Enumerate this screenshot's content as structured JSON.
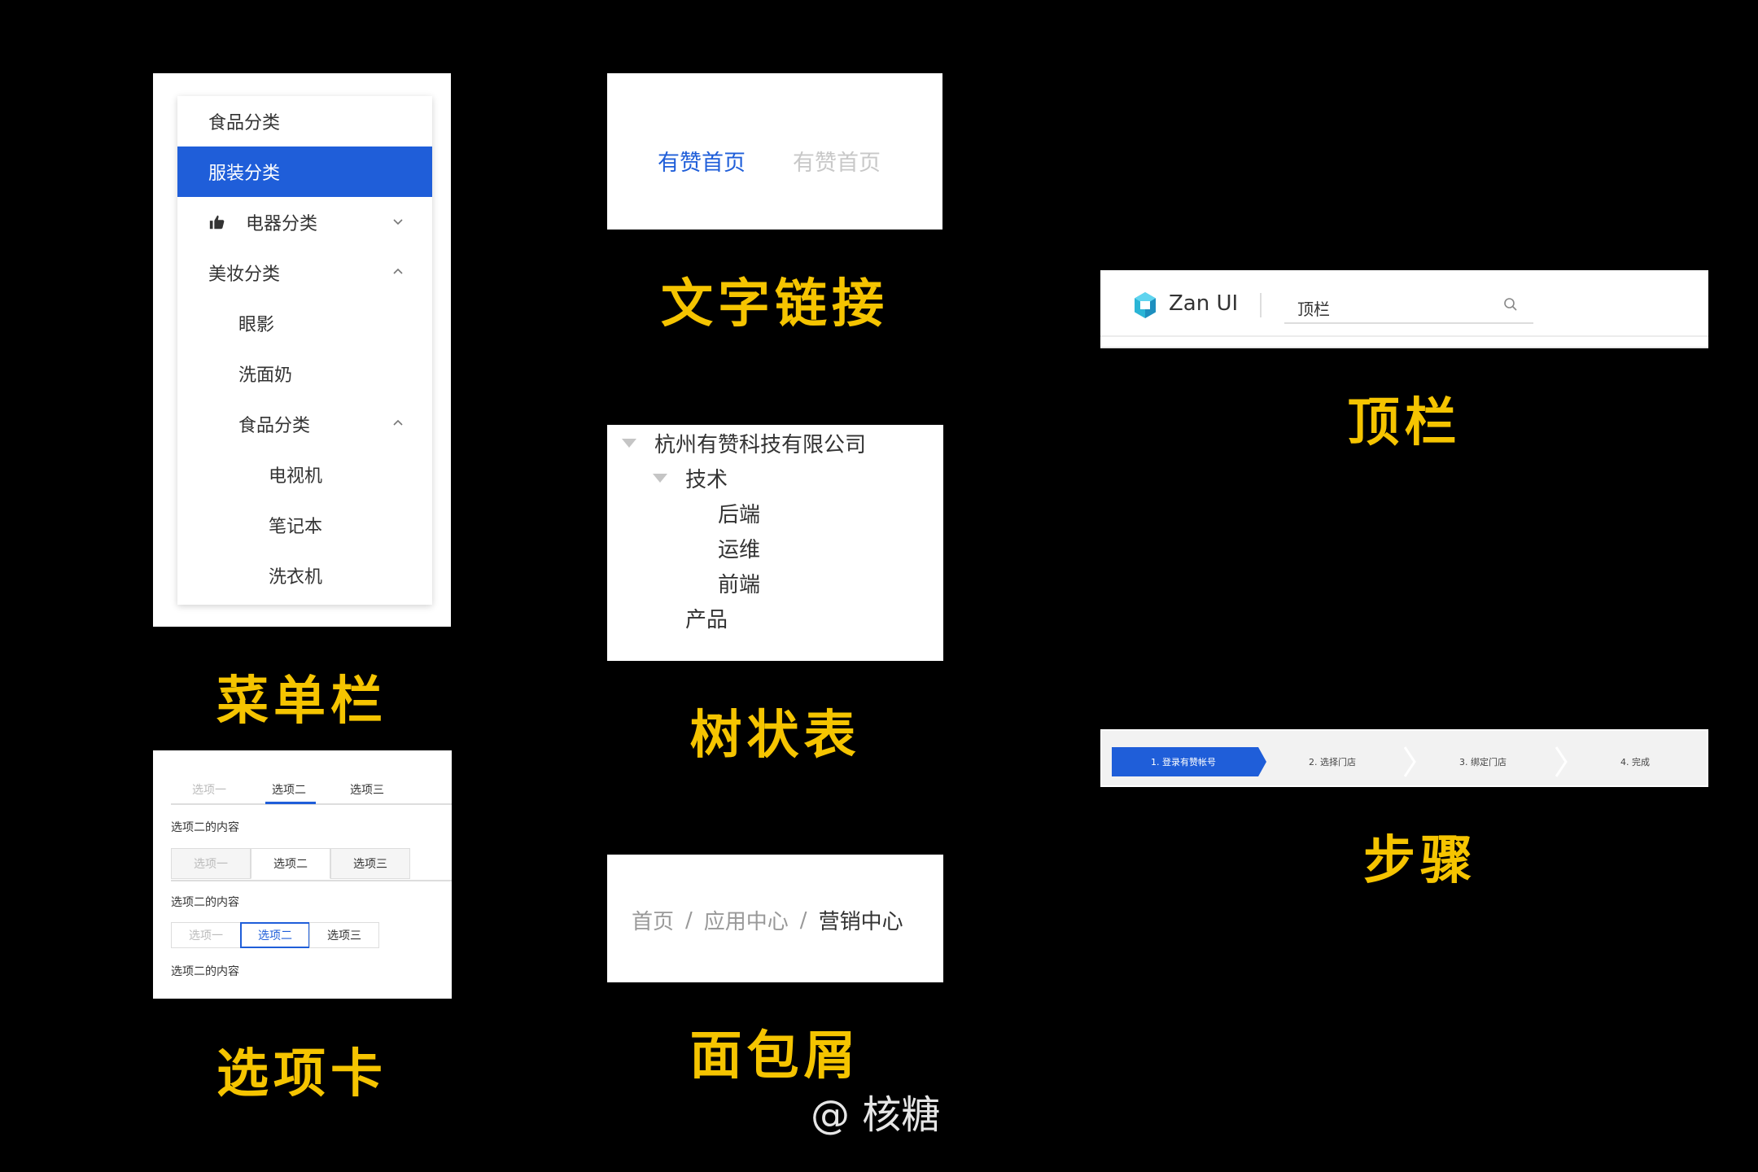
{
  "menu": {
    "items": [
      {
        "label": "食品分类",
        "indent": 0,
        "active": false,
        "icon": "",
        "chevron": ""
      },
      {
        "label": "服装分类",
        "indent": 0,
        "active": true,
        "icon": "",
        "chevron": ""
      },
      {
        "label": "电器分类",
        "indent": 0,
        "active": false,
        "icon": "thumbs-up-icon",
        "chevron": "down"
      },
      {
        "label": "美妆分类",
        "indent": 0,
        "active": false,
        "icon": "",
        "chevron": "up"
      },
      {
        "label": "眼影",
        "indent": 1,
        "active": false,
        "icon": "",
        "chevron": ""
      },
      {
        "label": "洗面奶",
        "indent": 1,
        "active": false,
        "icon": "",
        "chevron": ""
      },
      {
        "label": "食品分类",
        "indent": 1,
        "active": false,
        "icon": "",
        "chevron": "up"
      },
      {
        "label": "电视机",
        "indent": 2,
        "active": false,
        "icon": "",
        "chevron": ""
      },
      {
        "label": "笔记本",
        "indent": 2,
        "active": false,
        "icon": "",
        "chevron": ""
      },
      {
        "label": "洗衣机",
        "indent": 2,
        "active": false,
        "icon": "",
        "chevron": ""
      }
    ],
    "caption": "菜单栏"
  },
  "text_link": {
    "active_label": "有赞首页",
    "disabled_label": "有赞首页",
    "caption": "文字链接"
  },
  "tree": {
    "nodes": [
      {
        "label": "杭州有赞科技有限公司",
        "level": 0,
        "expandable": true
      },
      {
        "label": "技术",
        "level": 1,
        "expandable": true
      },
      {
        "label": "后端",
        "level": 2,
        "expandable": false
      },
      {
        "label": "运维",
        "level": 2,
        "expandable": false
      },
      {
        "label": "前端",
        "level": 2,
        "expandable": false
      },
      {
        "label": "产品",
        "level": 1,
        "expandable": false
      }
    ],
    "caption": "树状表"
  },
  "topbar": {
    "brand": "Zan UI",
    "search_value": "顶栏",
    "caption": "顶栏"
  },
  "tabs": {
    "labels": [
      "选项一",
      "选项二",
      "选项三"
    ],
    "content": "选项二的内容",
    "caption": "选项卡"
  },
  "breadcrumb": {
    "items": [
      "首页",
      "应用中心",
      "营销中心"
    ],
    "separator": "/",
    "caption": "面包屑"
  },
  "steps": {
    "items": [
      "1. 登录有赞帐号",
      "2. 选择门店",
      "3. 绑定门店",
      "4. 完成"
    ],
    "caption": "步骤"
  },
  "signature": "@ 核糖",
  "colors": {
    "primary": "#1f5ed9",
    "caption": "#f5c400",
    "background": "#000000"
  }
}
